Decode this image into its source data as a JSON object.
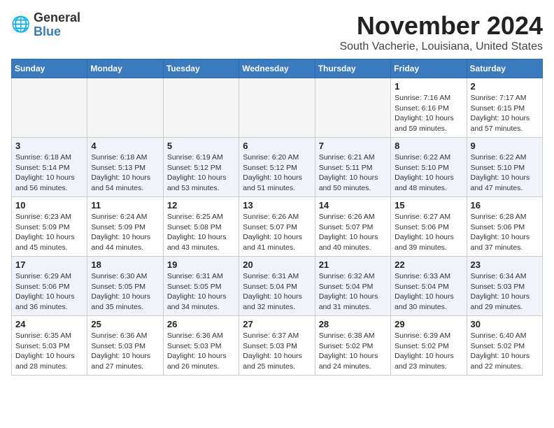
{
  "logo": {
    "general": "General",
    "blue": "Blue"
  },
  "header": {
    "month": "November 2024",
    "location": "South Vacherie, Louisiana, United States"
  },
  "weekdays": [
    "Sunday",
    "Monday",
    "Tuesday",
    "Wednesday",
    "Thursday",
    "Friday",
    "Saturday"
  ],
  "weeks": [
    [
      {
        "day": "",
        "info": ""
      },
      {
        "day": "",
        "info": ""
      },
      {
        "day": "",
        "info": ""
      },
      {
        "day": "",
        "info": ""
      },
      {
        "day": "",
        "info": ""
      },
      {
        "day": "1",
        "info": "Sunrise: 7:16 AM\nSunset: 6:16 PM\nDaylight: 10 hours\nand 59 minutes."
      },
      {
        "day": "2",
        "info": "Sunrise: 7:17 AM\nSunset: 6:15 PM\nDaylight: 10 hours\nand 57 minutes."
      }
    ],
    [
      {
        "day": "3",
        "info": "Sunrise: 6:18 AM\nSunset: 5:14 PM\nDaylight: 10 hours\nand 56 minutes."
      },
      {
        "day": "4",
        "info": "Sunrise: 6:18 AM\nSunset: 5:13 PM\nDaylight: 10 hours\nand 54 minutes."
      },
      {
        "day": "5",
        "info": "Sunrise: 6:19 AM\nSunset: 5:12 PM\nDaylight: 10 hours\nand 53 minutes."
      },
      {
        "day": "6",
        "info": "Sunrise: 6:20 AM\nSunset: 5:12 PM\nDaylight: 10 hours\nand 51 minutes."
      },
      {
        "day": "7",
        "info": "Sunrise: 6:21 AM\nSunset: 5:11 PM\nDaylight: 10 hours\nand 50 minutes."
      },
      {
        "day": "8",
        "info": "Sunrise: 6:22 AM\nSunset: 5:10 PM\nDaylight: 10 hours\nand 48 minutes."
      },
      {
        "day": "9",
        "info": "Sunrise: 6:22 AM\nSunset: 5:10 PM\nDaylight: 10 hours\nand 47 minutes."
      }
    ],
    [
      {
        "day": "10",
        "info": "Sunrise: 6:23 AM\nSunset: 5:09 PM\nDaylight: 10 hours\nand 45 minutes."
      },
      {
        "day": "11",
        "info": "Sunrise: 6:24 AM\nSunset: 5:09 PM\nDaylight: 10 hours\nand 44 minutes."
      },
      {
        "day": "12",
        "info": "Sunrise: 6:25 AM\nSunset: 5:08 PM\nDaylight: 10 hours\nand 43 minutes."
      },
      {
        "day": "13",
        "info": "Sunrise: 6:26 AM\nSunset: 5:07 PM\nDaylight: 10 hours\nand 41 minutes."
      },
      {
        "day": "14",
        "info": "Sunrise: 6:26 AM\nSunset: 5:07 PM\nDaylight: 10 hours\nand 40 minutes."
      },
      {
        "day": "15",
        "info": "Sunrise: 6:27 AM\nSunset: 5:06 PM\nDaylight: 10 hours\nand 39 minutes."
      },
      {
        "day": "16",
        "info": "Sunrise: 6:28 AM\nSunset: 5:06 PM\nDaylight: 10 hours\nand 37 minutes."
      }
    ],
    [
      {
        "day": "17",
        "info": "Sunrise: 6:29 AM\nSunset: 5:06 PM\nDaylight: 10 hours\nand 36 minutes."
      },
      {
        "day": "18",
        "info": "Sunrise: 6:30 AM\nSunset: 5:05 PM\nDaylight: 10 hours\nand 35 minutes."
      },
      {
        "day": "19",
        "info": "Sunrise: 6:31 AM\nSunset: 5:05 PM\nDaylight: 10 hours\nand 34 minutes."
      },
      {
        "day": "20",
        "info": "Sunrise: 6:31 AM\nSunset: 5:04 PM\nDaylight: 10 hours\nand 32 minutes."
      },
      {
        "day": "21",
        "info": "Sunrise: 6:32 AM\nSunset: 5:04 PM\nDaylight: 10 hours\nand 31 minutes."
      },
      {
        "day": "22",
        "info": "Sunrise: 6:33 AM\nSunset: 5:04 PM\nDaylight: 10 hours\nand 30 minutes."
      },
      {
        "day": "23",
        "info": "Sunrise: 6:34 AM\nSunset: 5:03 PM\nDaylight: 10 hours\nand 29 minutes."
      }
    ],
    [
      {
        "day": "24",
        "info": "Sunrise: 6:35 AM\nSunset: 5:03 PM\nDaylight: 10 hours\nand 28 minutes."
      },
      {
        "day": "25",
        "info": "Sunrise: 6:36 AM\nSunset: 5:03 PM\nDaylight: 10 hours\nand 27 minutes."
      },
      {
        "day": "26",
        "info": "Sunrise: 6:36 AM\nSunset: 5:03 PM\nDaylight: 10 hours\nand 26 minutes."
      },
      {
        "day": "27",
        "info": "Sunrise: 6:37 AM\nSunset: 5:03 PM\nDaylight: 10 hours\nand 25 minutes."
      },
      {
        "day": "28",
        "info": "Sunrise: 6:38 AM\nSunset: 5:02 PM\nDaylight: 10 hours\nand 24 minutes."
      },
      {
        "day": "29",
        "info": "Sunrise: 6:39 AM\nSunset: 5:02 PM\nDaylight: 10 hours\nand 23 minutes."
      },
      {
        "day": "30",
        "info": "Sunrise: 6:40 AM\nSunset: 5:02 PM\nDaylight: 10 hours\nand 22 minutes."
      }
    ]
  ]
}
